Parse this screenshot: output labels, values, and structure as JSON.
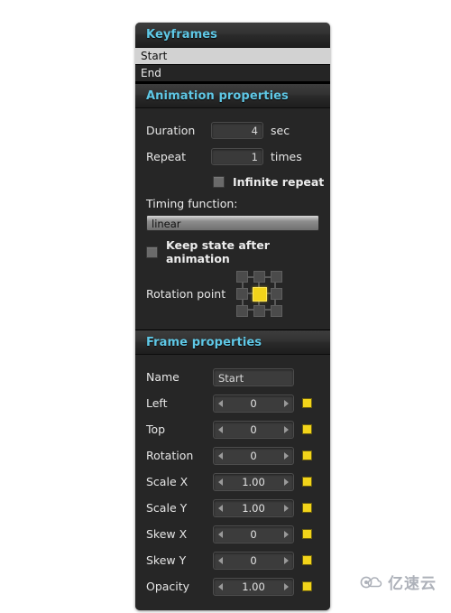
{
  "keyframes": {
    "title": "Keyframes",
    "items": [
      {
        "label": "Start",
        "selected": true
      },
      {
        "label": "End",
        "selected": false
      }
    ]
  },
  "animation": {
    "title": "Animation properties",
    "duration": {
      "label": "Duration",
      "value": "4",
      "unit": "sec"
    },
    "repeat": {
      "label": "Repeat",
      "value": "1",
      "unit": "times"
    },
    "infinite_repeat": {
      "label": "Infinite repeat",
      "checked": false
    },
    "timing_function": {
      "label": "Timing function:",
      "value": "linear"
    },
    "keep_state": {
      "label": "Keep state after animation",
      "checked": false
    },
    "rotation_point": {
      "label": "Rotation point",
      "selected": "center"
    }
  },
  "frame": {
    "title": "Frame properties",
    "name": {
      "label": "Name",
      "value": "Start"
    },
    "properties": [
      {
        "label": "Left",
        "value": "0"
      },
      {
        "label": "Top",
        "value": "0"
      },
      {
        "label": "Rotation",
        "value": "0"
      },
      {
        "label": "Scale X",
        "value": "1.00"
      },
      {
        "label": "Scale Y",
        "value": "1.00"
      },
      {
        "label": "Skew X",
        "value": "0"
      },
      {
        "label": "Skew Y",
        "value": "0"
      },
      {
        "label": "Opacity",
        "value": "1.00"
      }
    ]
  },
  "watermark": {
    "text": "亿速云"
  },
  "colors": {
    "accent": "#5fc8e6",
    "swatch": "#f2d41a",
    "panel_bg": "#262626",
    "header_bg": "#323232"
  }
}
